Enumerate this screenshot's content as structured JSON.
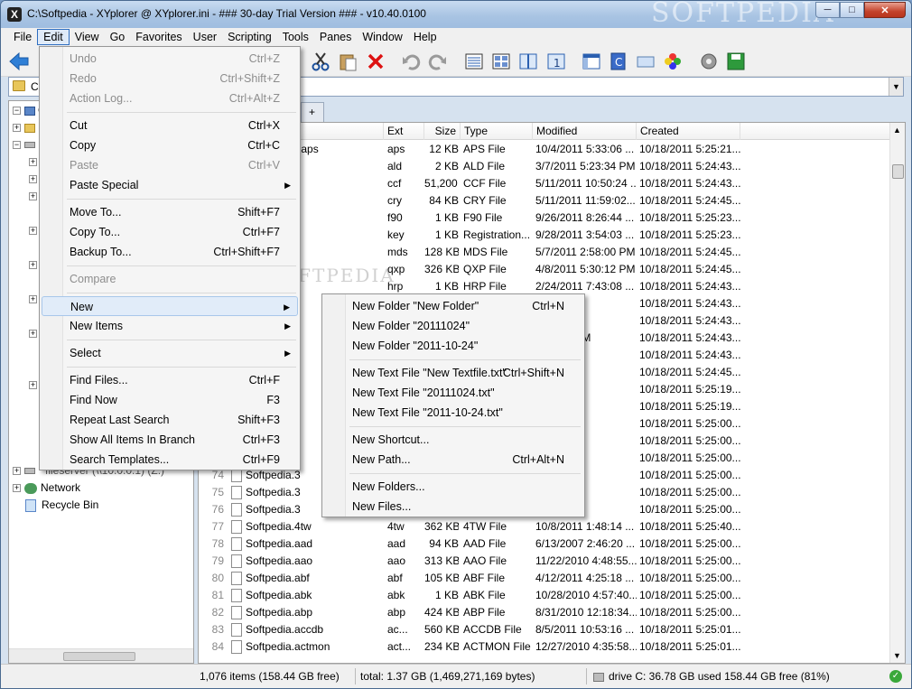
{
  "title": "C:\\Softpedia - XYplorer @ XYplorer.ini - ### 30-day Trial Version ### - v10.40.0100",
  "watermark": "SOFTPEDIA",
  "caption_buttons": {
    "minimize": "─",
    "maximize": "□",
    "close": "✕"
  },
  "menubar": [
    "File",
    "Edit",
    "View",
    "Go",
    "Favorites",
    "User",
    "Scripting",
    "Tools",
    "Panes",
    "Window",
    "Help"
  ],
  "address": {
    "value": "C:"
  },
  "tree": {
    "top": "C",
    "network": "Network",
    "recycle": "Recycle Bin",
    "partial": "fileserver (\\\\10.0.0.1) (Z:)"
  },
  "tabs": {
    "plus": "+"
  },
  "columns": {
    "ext": "Ext",
    "size": "Size",
    "type": "Type",
    "modified": "Modified",
    "created": "Created"
  },
  "rows": [
    {
      "num": "",
      "name": "reen Saver.aps",
      "ext": "aps",
      "size": "12 KB",
      "type": "APS File",
      "modified": "10/4/2011 5:33:06 ...",
      "created": "10/18/2011 5:25:21..."
    },
    {
      "num": "",
      "name": "ld",
      "ext": "ald",
      "size": "2 KB",
      "type": "ALD File",
      "modified": "3/7/2011 5:23:34 PM",
      "created": "10/18/2011 5:24:43..."
    },
    {
      "num": "",
      "name": "cf",
      "ext": "ccf",
      "size": "51,200 ...",
      "type": "CCF File",
      "modified": "5/11/2011 10:50:24 ...",
      "created": "10/18/2011 5:24:43..."
    },
    {
      "num": "",
      "name": "ry",
      "ext": "cry",
      "size": "84 KB",
      "type": "CRY File",
      "modified": "5/11/2011 11:59:02...",
      "created": "10/18/2011 5:24:45..."
    },
    {
      "num": "",
      "name": "90",
      "ext": "f90",
      "size": "1 KB",
      "type": "F90 File",
      "modified": "9/26/2011 8:26:44 ...",
      "created": "10/18/2011 5:25:23..."
    },
    {
      "num": "",
      "name": "ey",
      "ext": "key",
      "size": "1 KB",
      "type": "Registration...",
      "modified": "9/28/2011 3:54:03 ...",
      "created": "10/18/2011 5:25:23..."
    },
    {
      "num": "",
      "name": "nds",
      "ext": "mds",
      "size": "128 KB",
      "type": "MDS File",
      "modified": "5/7/2011 2:58:00 PM",
      "created": "10/18/2011 5:24:45..."
    },
    {
      "num": "",
      "name": "xp",
      "ext": "qxp",
      "size": "326 KB",
      "type": "QXP File",
      "modified": "4/8/2011 5:30:12 PM",
      "created": "10/18/2011 5:24:45..."
    },
    {
      "num": "",
      "name": "roject.hrp",
      "ext": "hrp",
      "size": "1 KB",
      "type": "HRP File",
      "modified": "2/24/2011 7:43:08 ...",
      "created": "10/18/2011 5:24:43..."
    },
    {
      "num": "",
      "name": "",
      "ext": "",
      "size": "",
      "type": "",
      "modified": "2:31:24 ...",
      "created": "10/18/2011 5:24:43..."
    },
    {
      "num": "",
      "name": "",
      "ext": "",
      "size": "",
      "type": "",
      "modified": "2:31:12 ...",
      "created": "10/18/2011 5:24:43..."
    },
    {
      "num": "",
      "name": "",
      "ext": "",
      "size": "",
      "type": "",
      "modified": "4:47:48 PM",
      "created": "10/18/2011 5:24:43..."
    },
    {
      "num": "",
      "name": "",
      "ext": "",
      "size": "",
      "type": "",
      "modified": "1:10:36 ...",
      "created": "10/18/2011 5:24:43..."
    },
    {
      "num": "",
      "name": "",
      "ext": "",
      "size": "",
      "type": "",
      "modified": "9:51:15 ...",
      "created": "10/18/2011 5:24:45..."
    },
    {
      "num": "",
      "name": "",
      "ext": "",
      "size": "",
      "type": "",
      "modified": "2:57:26 ...",
      "created": "10/18/2011 5:25:19..."
    },
    {
      "num": "",
      "name": "",
      "ext": "",
      "size": "",
      "type": "",
      "modified": "1:49:08 ...",
      "created": "10/18/2011 5:25:19..."
    },
    {
      "num": "",
      "name": "",
      "ext": "",
      "size": "",
      "type": "",
      "modified": "1:56:00 ...",
      "created": "10/18/2011 5:25:00..."
    },
    {
      "num": "",
      "name": "",
      "ext": "",
      "size": "",
      "type": "",
      "modified": "2:37:36 ...",
      "created": "10/18/2011 5:25:00..."
    },
    {
      "num": "",
      "name": "",
      "ext": "",
      "size": "",
      "type": "",
      "modified": "1:43:18 ...",
      "created": "10/18/2011 5:25:00..."
    },
    {
      "num": "74",
      "name": "Softpedia.3",
      "ext": "",
      "size": "",
      "type": "",
      "modified": "7:07:58 ...",
      "created": "10/18/2011 5:25:00..."
    },
    {
      "num": "75",
      "name": "Softpedia.3",
      "ext": "",
      "size": "",
      "type": "",
      "modified": "8:19:10 ...",
      "created": "10/18/2011 5:25:00..."
    },
    {
      "num": "76",
      "name": "Softpedia.3",
      "ext": "",
      "size": "",
      "type": "",
      "modified": "12:16:4 ...",
      "created": "10/18/2011 5:25:00..."
    },
    {
      "num": "77",
      "name": "Softpedia.4tw",
      "ext": "4tw",
      "size": "362 KB",
      "type": "4TW File",
      "modified": "10/8/2011 1:48:14 ...",
      "created": "10/18/2011 5:25:40..."
    },
    {
      "num": "78",
      "name": "Softpedia.aad",
      "ext": "aad",
      "size": "94 KB",
      "type": "AAD File",
      "modified": "6/13/2007 2:46:20 ...",
      "created": "10/18/2011 5:25:00..."
    },
    {
      "num": "79",
      "name": "Softpedia.aao",
      "ext": "aao",
      "size": "313 KB",
      "type": "AAO File",
      "modified": "11/22/2010 4:48:55...",
      "created": "10/18/2011 5:25:00..."
    },
    {
      "num": "80",
      "name": "Softpedia.abf",
      "ext": "abf",
      "size": "105 KB",
      "type": "ABF File",
      "modified": "4/12/2011 4:25:18 ...",
      "created": "10/18/2011 5:25:00..."
    },
    {
      "num": "81",
      "name": "Softpedia.abk",
      "ext": "abk",
      "size": "1 KB",
      "type": "ABK File",
      "modified": "10/28/2010 4:57:40...",
      "created": "10/18/2011 5:25:00..."
    },
    {
      "num": "82",
      "name": "Softpedia.abp",
      "ext": "abp",
      "size": "424 KB",
      "type": "ABP File",
      "modified": "8/31/2010 12:18:34...",
      "created": "10/18/2011 5:25:00..."
    },
    {
      "num": "83",
      "name": "Softpedia.accdb",
      "ext": "ac...",
      "size": "560 KB",
      "type": "ACCDB File",
      "modified": "8/5/2011 10:53:16 ...",
      "created": "10/18/2011 5:25:01..."
    },
    {
      "num": "84",
      "name": "Softpedia.actmon",
      "ext": "act...",
      "size": "234 KB",
      "type": "ACTMON File",
      "modified": "12/27/2010 4:35:58...",
      "created": "10/18/2011 5:25:01..."
    }
  ],
  "status": {
    "items": "1,076 items (158.44 GB free)",
    "total": "total: 1.37 GB (1,469,271,169 bytes)",
    "drive": "drive C:  36.78 GB used   158.44 GB free (81%)"
  },
  "edit_menu": [
    {
      "label": "Undo",
      "shortcut": "Ctrl+Z",
      "disabled": true
    },
    {
      "label": "Redo",
      "shortcut": "Ctrl+Shift+Z",
      "disabled": true
    },
    {
      "label": "Action Log...",
      "shortcut": "Ctrl+Alt+Z",
      "disabled": true
    },
    {
      "label": "Cut",
      "shortcut": "Ctrl+X"
    },
    {
      "label": "Copy",
      "shortcut": "Ctrl+C"
    },
    {
      "label": "Paste",
      "shortcut": "Ctrl+V",
      "disabled": true
    },
    {
      "label": "Paste Special",
      "shortcut": "",
      "submenu": true
    },
    {
      "label": "Move To...",
      "shortcut": "Shift+F7"
    },
    {
      "label": "Copy To...",
      "shortcut": "Ctrl+F7"
    },
    {
      "label": "Backup To...",
      "shortcut": "Ctrl+Shift+F7"
    },
    {
      "label": "Compare",
      "shortcut": "",
      "disabled": true
    },
    {
      "label": "New",
      "shortcut": "",
      "submenu": true,
      "highlight": true
    },
    {
      "label": "New Items",
      "shortcut": "",
      "submenu": true
    },
    {
      "label": "Select",
      "shortcut": "",
      "submenu": true
    },
    {
      "label": "Find Files...",
      "shortcut": "Ctrl+F"
    },
    {
      "label": "Find Now",
      "shortcut": "F3"
    },
    {
      "label": "Repeat Last Search",
      "shortcut": "Shift+F3"
    },
    {
      "label": "Show All Items In Branch",
      "shortcut": "Ctrl+F3"
    },
    {
      "label": "Search Templates...",
      "shortcut": "Ctrl+F9"
    }
  ],
  "new_menu": [
    {
      "label": "New Folder \"New Folder\"",
      "shortcut": "Ctrl+N"
    },
    {
      "label": "New Folder \"20111024\"",
      "shortcut": ""
    },
    {
      "label": "New Folder \"2011-10-24\"",
      "shortcut": ""
    },
    {
      "label": "New Text File \"New Textfile.txt\"",
      "shortcut": "Ctrl+Shift+N"
    },
    {
      "label": "New Text File \"20111024.txt\"",
      "shortcut": ""
    },
    {
      "label": "New Text File \"2011-10-24.txt\"",
      "shortcut": ""
    },
    {
      "label": "New Shortcut...",
      "shortcut": ""
    },
    {
      "label": "New Path...",
      "shortcut": "Ctrl+Alt+N"
    },
    {
      "label": "New Folders...",
      "shortcut": ""
    },
    {
      "label": "New Files...",
      "shortcut": ""
    }
  ]
}
